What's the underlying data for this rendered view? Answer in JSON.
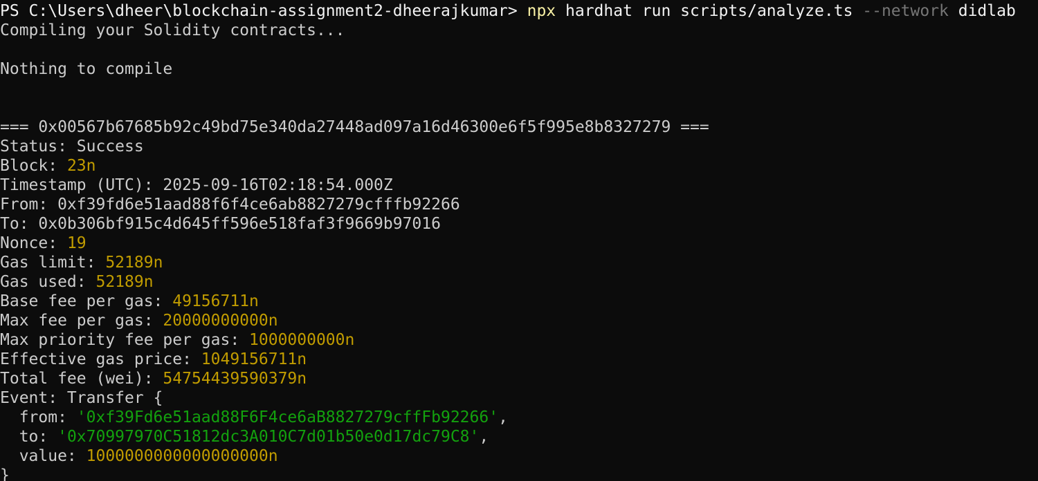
{
  "terminal": {
    "lines": [
      [
        {
          "t": "PS C:\\Users\\dheer\\blockchain-assignment2-dheerajkumar> ",
          "c": "white"
        },
        {
          "t": "npx",
          "c": "yellow"
        },
        {
          "t": " hardhat run scripts/analyze.ts ",
          "c": "white"
        },
        {
          "t": "--network",
          "c": "gray"
        },
        {
          "t": " didlab",
          "c": "white"
        }
      ],
      [
        {
          "t": "Compiling your Solidity contracts...",
          "c": "default"
        }
      ],
      [],
      [
        {
          "t": "Nothing to compile",
          "c": "default"
        }
      ],
      [],
      [],
      [
        {
          "t": "=== 0x00567b67685b92c49bd75e340da27448ad097a16d46300e6f5f995e8b8327279 ===",
          "c": "default"
        }
      ],
      [
        {
          "t": "Status: Success",
          "c": "default"
        }
      ],
      [
        {
          "t": "Block: ",
          "c": "default"
        },
        {
          "t": "23n",
          "c": "num"
        }
      ],
      [
        {
          "t": "Timestamp (UTC): 2025-09-16T02:18:54.000Z",
          "c": "default"
        }
      ],
      [
        {
          "t": "From: 0xf39fd6e51aad88f6f4ce6ab8827279cfffb92266",
          "c": "default"
        }
      ],
      [
        {
          "t": "To: 0x0b306bf915c4d645ff596e518faf3f9669b97016",
          "c": "default"
        }
      ],
      [
        {
          "t": "Nonce: ",
          "c": "default"
        },
        {
          "t": "19",
          "c": "num"
        }
      ],
      [
        {
          "t": "Gas limit: ",
          "c": "default"
        },
        {
          "t": "52189n",
          "c": "num"
        }
      ],
      [
        {
          "t": "Gas used: ",
          "c": "default"
        },
        {
          "t": "52189n",
          "c": "num"
        }
      ],
      [
        {
          "t": "Base fee per gas: ",
          "c": "default"
        },
        {
          "t": "49156711n",
          "c": "num"
        }
      ],
      [
        {
          "t": "Max fee per gas: ",
          "c": "default"
        },
        {
          "t": "20000000000n",
          "c": "num"
        }
      ],
      [
        {
          "t": "Max priority fee per gas: ",
          "c": "default"
        },
        {
          "t": "1000000000n",
          "c": "num"
        }
      ],
      [
        {
          "t": "Effective gas price: ",
          "c": "default"
        },
        {
          "t": "1049156711n",
          "c": "num"
        }
      ],
      [
        {
          "t": "Total fee (wei): ",
          "c": "default"
        },
        {
          "t": "54754439590379n",
          "c": "num"
        }
      ],
      [
        {
          "t": "Event: Transfer {",
          "c": "default"
        }
      ],
      [
        {
          "t": "  from: ",
          "c": "default"
        },
        {
          "t": "'0xf39Fd6e51aad88F6F4ce6aB8827279cffFb92266'",
          "c": "str"
        },
        {
          "t": ",",
          "c": "default"
        }
      ],
      [
        {
          "t": "  to: ",
          "c": "default"
        },
        {
          "t": "'0x70997970C51812dc3A010C7d01b50e0d17dc79C8'",
          "c": "str"
        },
        {
          "t": ",",
          "c": "default"
        }
      ],
      [
        {
          "t": "  value: ",
          "c": "default"
        },
        {
          "t": "1000000000000000000n",
          "c": "num"
        }
      ],
      [
        {
          "t": "}",
          "c": "default"
        }
      ]
    ]
  },
  "colors": {
    "background": "#0c0c0c",
    "default": "#cccccc",
    "white": "#f2f2f2",
    "yellow": "#f9f1a5",
    "gray": "#767676",
    "num": "#c19c00",
    "str": "#13a10e"
  }
}
